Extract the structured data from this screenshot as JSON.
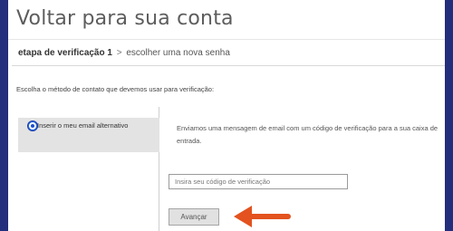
{
  "page": {
    "title": "Voltar para sua conta"
  },
  "breadcrumb": {
    "current_step": "etapa de verificação 1",
    "separator": ">",
    "next_step": "escolher uma nova senha"
  },
  "instruction": "Escolha o método de contato que devemos usar para verificação:",
  "options": [
    {
      "label": "Inserir o meu email alternativo",
      "selected": true
    }
  ],
  "verification": {
    "message": "Enviamos uma mensagem de email com um código de verificação para a sua caixa de entrada.",
    "code_placeholder": "Insira seu código de verificação",
    "submit_label": "Avançar"
  },
  "colors": {
    "frame": "#232e7d",
    "arrow": "#e3521f",
    "radio_selected": "#1a4fd0"
  },
  "icons": {
    "annotation": "arrow-left-icon",
    "radio": "radio-selected-icon"
  }
}
